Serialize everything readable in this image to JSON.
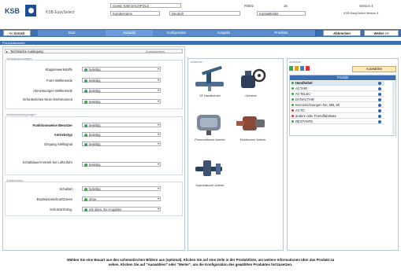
{
  "header": {
    "guest_label": "Guest: KSB DACHPOLS",
    "session_code": "F5002",
    "session_num": "16",
    "version": "Version 4",
    "brand": "KSB EasySelect",
    "logo": "KSB",
    "customer_label": "Kundenname",
    "language": "Deutsch",
    "contact_label": "Kontaktfelder",
    "top_right": "KSB EasySelect Version 4"
  },
  "nav": {
    "back": "<< Zurück",
    "tabs": [
      "Start",
      "Auswahl",
      "Konfiguration",
      "Ausgabe",
      "Preisliste"
    ],
    "finish": "Abbrechen",
    "next": "Weiter >>"
  },
  "subbar": "Produktauswahl",
  "left": {
    "search_value": "Technische Auslegung",
    "search_button": "Zurücksetzen",
    "group1_title": "Ventilauslegungen",
    "group1_rows": [
      {
        "label": "Klappenwerkstoffe",
        "value": "beliebig"
      },
      {
        "label": "Form Wellenende",
        "value": "beliebig"
      },
      {
        "label": "Abmessungen Wellenende",
        "value": "beliebig"
      },
      {
        "label": "Erforderliches Nenn-Drehmoment",
        "value": "beliebig"
      }
    ],
    "group2_title": "Antriebsauslegungen",
    "group2_rows": [
      {
        "label": "Funktionsweise Benutzer",
        "value": "beliebig"
      },
      {
        "label": "Antriebstyp",
        "value": "beliebig"
      },
      {
        "label": "Eingang Stellsignal",
        "value": "beliebig"
      },
      {
        "label": "Schaltdauer/Antrieb bei Luftzufuhr",
        "value": "beliebig"
      }
    ],
    "group3_title": "Zubehörung",
    "group3_rows": [
      {
        "label": "Schaltart",
        "value": "beliebig"
      },
      {
        "label": "Explosionsschutz/Zonen",
        "value": "ohne"
      },
      {
        "label": "Schutzart/Umg.",
        "value": "mit oben. Ex-Angaben"
      }
    ]
  },
  "middle": {
    "title": "Antriebe",
    "products": [
      {
        "name": "SF Handbetrieb",
        "icon": "manual-actuator-icon"
      },
      {
        "name": "Getriebe",
        "icon": "gearbox-icon"
      },
      {
        "name": "Pneumatischer Antrieb",
        "icon": "pneumatic-actuator-icon"
      },
      {
        "name": "Elektrischer Antrieb",
        "icon": "electric-actuator-icon"
      },
      {
        "name": "Hydraulischer Antrieb",
        "icon": "hydraulic-actuator-icon"
      }
    ]
  },
  "right": {
    "title": "Antriebe",
    "button": "Auswählen",
    "list_header": "Produkt",
    "items": [
      {
        "name": "Handhebel",
        "status": "ok",
        "selected": true
      },
      {
        "name": "ACTAIR",
        "status": "ok"
      },
      {
        "name": "ACTELEC",
        "status": "ok"
      },
      {
        "name": "DYNACTAIR",
        "status": "ok"
      },
      {
        "name": "Kennzeichnungen NA, MB, MI",
        "status": "ok"
      },
      {
        "name": "ACTO",
        "status": "error"
      },
      {
        "name": "andere oder Fremdfabrikate",
        "status": "error"
      },
      {
        "name": "RESTANTE",
        "status": "ok"
      }
    ]
  },
  "footer": {
    "line1": "Wählen Sie eine Bauart aus den schematischen Bildern aus (optional). Klicken Sie auf eine Zeile in der Produktliste, um weitere Informationen über das Produkt zu",
    "line2": "sehen. Klicken Sie auf \"Auswählen\" oder \"Weiter\", um die Konfiguration des gewählten Produktes fortzusetzen."
  }
}
